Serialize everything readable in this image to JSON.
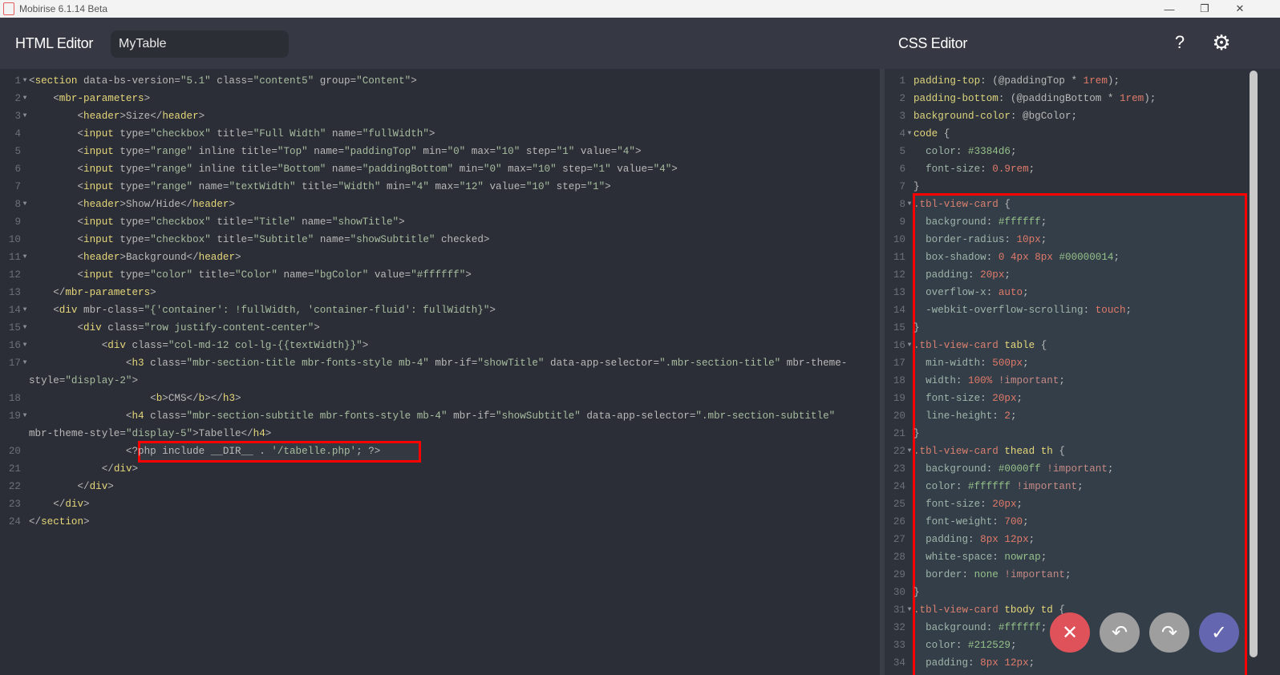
{
  "window": {
    "title": "Mobirise 6.1.14 Beta",
    "minimize": "—",
    "maximize": "❐",
    "close": "✕"
  },
  "header": {
    "html_title": "HTML Editor",
    "block_name": "MyTable",
    "css_title": "CSS Editor",
    "help": "?",
    "settings": "⚙"
  },
  "html_editor": {
    "folds": [
      1,
      2,
      3,
      8,
      11,
      14,
      15,
      16,
      17,
      19
    ],
    "lines": [
      "<section data-bs-version=\"5.1\" class=\"content5\" group=\"Content\">",
      "    <mbr-parameters>",
      "        <header>Size</header>",
      "        <input type=\"checkbox\" title=\"Full Width\" name=\"fullWidth\">",
      "        <input type=\"range\" inline title=\"Top\" name=\"paddingTop\" min=\"0\" max=\"10\" step=\"1\" value=\"4\">",
      "        <input type=\"range\" inline title=\"Bottom\" name=\"paddingBottom\" min=\"0\" max=\"10\" step=\"1\" value=\"4\">",
      "        <input type=\"range\" name=\"textWidth\" title=\"Width\" min=\"4\" max=\"12\" value=\"10\" step=\"1\">",
      "        <header>Show/Hide</header>",
      "        <input type=\"checkbox\" title=\"Title\" name=\"showTitle\">",
      "        <input type=\"checkbox\" title=\"Subtitle\" name=\"showSubtitle\" checked>",
      "        <header>Background</header>",
      "        <input type=\"color\" title=\"Color\" name=\"bgColor\" value=\"#ffffff\">",
      "    </mbr-parameters>",
      "    <div mbr-class=\"{'container': !fullWidth, 'container-fluid': fullWidth}\">",
      "        <div class=\"row justify-content-center\">",
      "            <div class=\"col-md-12 col-lg-{{textWidth}}\">",
      "                <h3 class=\"mbr-section-title mbr-fonts-style mb-4\" mbr-if=\"showTitle\" data-app-selector=\".mbr-section-title\" mbr-theme-style=\"display-2\">",
      "                    <b>CMS</b></h3>",
      "                <h4 class=\"mbr-section-subtitle mbr-fonts-style mb-4\" mbr-if=\"showSubtitle\" data-app-selector=\".mbr-section-subtitle\" mbr-theme-style=\"display-5\">Tabelle</h4>",
      "                <?php include __DIR__ . '/tabelle.php'; ?>",
      "            </div>",
      "        </div>",
      "    </div>",
      "</section>"
    ]
  },
  "css_editor": {
    "folds": [
      4,
      8,
      16,
      22,
      31
    ],
    "lines": [
      "padding-top: (@paddingTop * 1rem);",
      "padding-bottom: (@paddingBottom * 1rem);",
      "background-color: @bgColor;",
      "code {",
      "  color: #3384d6;",
      "  font-size: 0.9rem;",
      "}",
      ".tbl-view-card {",
      "  background: #ffffff;",
      "  border-radius: 10px;",
      "  box-shadow: 0 4px 8px #00000014;",
      "  padding: 20px;",
      "  overflow-x: auto;",
      "  -webkit-overflow-scrolling: touch;",
      "}",
      ".tbl-view-card table {",
      "  min-width: 500px;",
      "  width: 100% !important;",
      "  font-size: 20px;",
      "  line-height: 2;",
      "}",
      ".tbl-view-card thead th {",
      "  background: #0000ff !important;",
      "  color: #ffffff !important;",
      "  font-size: 20px;",
      "  font-weight: 700;",
      "  padding: 8px 12px;",
      "  white-space: nowrap;",
      "  border: none !important;",
      "}",
      ".tbl-view-card tbody td {",
      "  background: #ffffff;",
      "  color: #212529;",
      "  padding: 8px 12px;"
    ]
  },
  "actions": {
    "cancel": "✕",
    "undo": "↶",
    "redo": "↷",
    "apply": "✓"
  },
  "colors": {
    "cancel": "#e0525a",
    "neutral": "#9e9e9e",
    "apply": "#6466b0",
    "highlight": "#ff0000"
  }
}
